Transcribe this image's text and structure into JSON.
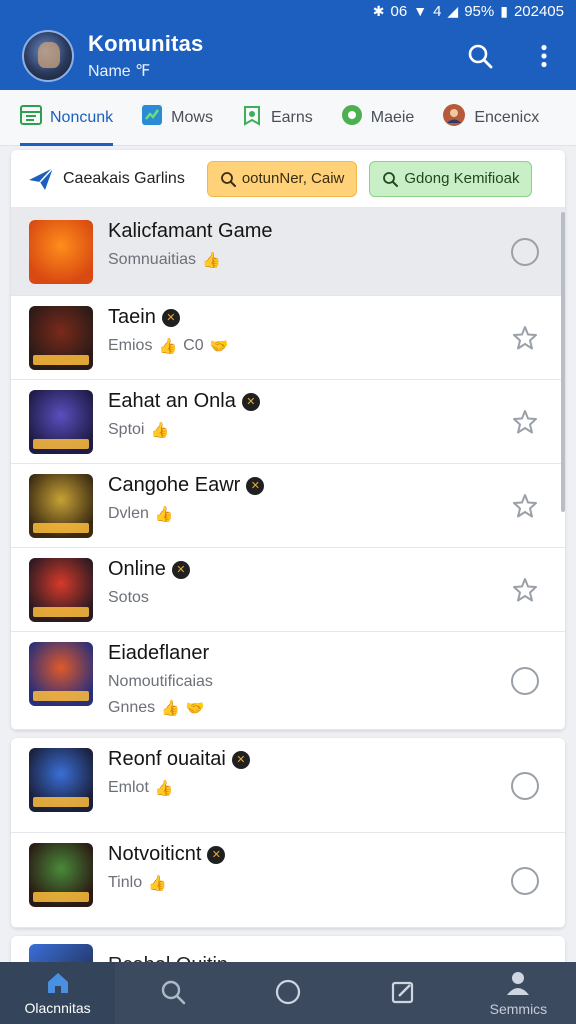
{
  "status_bar": {
    "left_text": "06",
    "signal_text": "4",
    "battery": "95%",
    "time": "202405"
  },
  "app_bar": {
    "title": "Komunitas",
    "subtitle": "Name ℉"
  },
  "tabs": [
    {
      "label": "Noncunk",
      "icon": "grid-icon",
      "color": "#2e9e4f",
      "active": true
    },
    {
      "label": "Mows",
      "icon": "chart-icon",
      "color": "#2a8bd6",
      "active": false
    },
    {
      "label": "Earns",
      "icon": "badge-icon",
      "color": "#3fae5a",
      "active": false
    },
    {
      "label": "Maeie",
      "icon": "circle-icon",
      "color": "#4caf50",
      "active": false
    },
    {
      "label": "Encenicx",
      "icon": "profile-icon",
      "color": "#b55a3a",
      "active": false
    }
  ],
  "filter": {
    "label": "Caeakais Garlins",
    "chip_search_label": "ootunNer, Caiw",
    "chip_green_label": "Gdong Kemifioak"
  },
  "rows": [
    {
      "title": "Kalicfamant Game",
      "subtitle": "Somnuaitias",
      "emoji": "👍",
      "badge": false,
      "trailing": "radio",
      "highlighted": true,
      "thumb_colors": [
        "#ff8d1a",
        "#d94a12"
      ]
    },
    {
      "title": "Taein",
      "subtitle": "Emios",
      "extra": "C0",
      "emoji": "👍",
      "emoji2": "🤝",
      "badge": true,
      "trailing": "star",
      "highlighted": false,
      "thumb_colors": [
        "#7a2a1a",
        "#2a1a18"
      ]
    },
    {
      "title": "Eahat an Onla",
      "subtitle": "Sptoi",
      "emoji": "👍",
      "badge": true,
      "trailing": "star",
      "highlighted": false,
      "thumb_colors": [
        "#5a4fbf",
        "#1e1b45"
      ]
    },
    {
      "title": "Cangohe Eawr",
      "subtitle": "Dvlen",
      "emoji": "👍",
      "badge": true,
      "trailing": "star",
      "highlighted": false,
      "thumb_colors": [
        "#c7a236",
        "#3a2a12"
      ]
    },
    {
      "title": "Online",
      "subtitle": "Sotos",
      "emoji": "",
      "badge": true,
      "trailing": "star",
      "highlighted": false,
      "thumb_colors": [
        "#d63a2a",
        "#2a1a22"
      ]
    },
    {
      "title": "Eiadeflaner",
      "subtitle": "Nomoutificaias",
      "line3": "Gnnes",
      "emoji": "👍",
      "emoji2": "🤝",
      "badge": false,
      "trailing": "radio",
      "highlighted": false,
      "thumb_colors": [
        "#e0592a",
        "#2a2f7a"
      ]
    }
  ],
  "rows_b": [
    {
      "title": "Reonf ouaitai",
      "subtitle": "Emlot",
      "emoji": "👍",
      "badge": true,
      "trailing": "radio",
      "thumb_colors": [
        "#3a6fd6",
        "#1a1f3a"
      ]
    },
    {
      "title": "Notvoiticnt",
      "subtitle": "Tinlo",
      "emoji": "👍",
      "badge": true,
      "trailing": "radio",
      "thumb_colors": [
        "#4a8a3a",
        "#2a1a14"
      ]
    }
  ],
  "partial_row": {
    "title": "Rcahel Ouitin"
  },
  "bottom_nav": [
    {
      "label": "Olacnnitas",
      "icon": "home-icon",
      "active": true
    },
    {
      "label": "",
      "icon": "search-icon",
      "active": false
    },
    {
      "label": "",
      "icon": "compass-icon",
      "active": false
    },
    {
      "label": "",
      "icon": "edit-icon",
      "active": false
    },
    {
      "label": "Semmics",
      "icon": "person-icon",
      "active": false
    }
  ]
}
